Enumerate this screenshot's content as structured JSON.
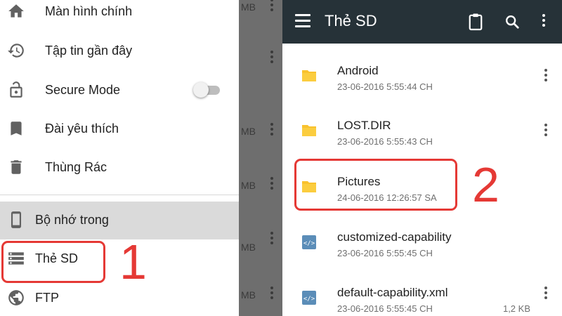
{
  "left_panel": {
    "drawer_items": [
      {
        "label": "Màn hình chính",
        "icon": "home-icon"
      },
      {
        "label": "Tập tin gần đây",
        "icon": "history-icon"
      },
      {
        "label": "Secure Mode",
        "icon": "lock-open-icon",
        "toggle_on": false
      },
      {
        "label": "Đài yêu thích",
        "icon": "bookmark-icon"
      },
      {
        "label": "Thùng Rác",
        "icon": "trash-icon"
      }
    ],
    "storage_items": [
      {
        "label": "Bộ nhớ trong",
        "icon": "phone-icon",
        "selected": true
      },
      {
        "label": "Thẻ SD",
        "icon": "list-storage-icon",
        "highlighted": true
      },
      {
        "label": "FTP",
        "icon": "globe-icon"
      }
    ],
    "background_size_unit": "MB",
    "annotation_number": "1"
  },
  "right_panel": {
    "appbar": {
      "title": "Thẻ SD",
      "bg_color": "#263238"
    },
    "files": [
      {
        "name": "Android",
        "date": "23-06-2016 5:55:44 CH",
        "type": "folder",
        "size": ""
      },
      {
        "name": "LOST.DIR",
        "date": "23-06-2016 5:55:43 CH",
        "type": "folder",
        "size": ""
      },
      {
        "name": "Pictures",
        "date": "24-06-2016 12:26:57 SA",
        "type": "folder",
        "size": "",
        "highlighted": true
      },
      {
        "name": "customized-capability",
        "date": "23-06-2016 5:55:45 CH",
        "type": "code-file",
        "size": ""
      },
      {
        "name": "default-capability.xml",
        "date": "23-06-2016 5:55:45 CH",
        "type": "code-file",
        "size": "1,2 KB"
      }
    ],
    "annotation_number": "2"
  },
  "colors": {
    "annotation_red": "#e53935",
    "folder_yellow": "#f9c22e",
    "code_file_blue": "#5b8db8"
  }
}
